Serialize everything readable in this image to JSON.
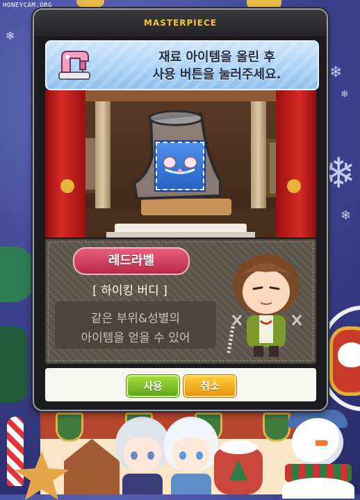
{
  "watermark": "HONEYCAM.ORG",
  "dialog": {
    "title": "MASTERPIECE",
    "instruction_line1": "재료 아이템을 올린 후",
    "instruction_line2": "사용 버튼을 눌러주세요.",
    "header_icon": "sewing-machine-icon",
    "slot_item_icon": "bunny-ear-headband-icon"
  },
  "result": {
    "rarity": "레드라벨",
    "item_name": "[ 하이킹 버디 ]",
    "description_line1": "같은 부위&성별의",
    "description_line2": "아이템을 얻을 수 있어"
  },
  "buttons": {
    "use": "사용",
    "cancel": "취소"
  },
  "colors": {
    "title": "#f6c23c",
    "rarity_badge": "#d2426a",
    "use_button": "#7cc222",
    "cancel_button": "#f5ad22"
  }
}
